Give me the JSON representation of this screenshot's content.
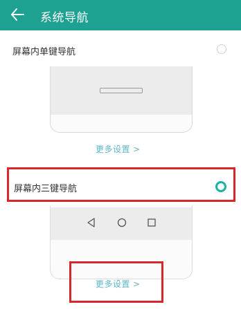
{
  "appbar": {
    "title": "系统导航",
    "back_icon": "back-arrow-icon"
  },
  "options": [
    {
      "label": "屏幕内单键导航",
      "selected": false,
      "more_label": "更多设置"
    },
    {
      "label": "屏幕内三键导航",
      "selected": true,
      "more_label": "更多设置"
    }
  ],
  "chevron": ">",
  "colors": {
    "accent": "#1da291",
    "radio_on": "#17b3a3",
    "highlight": "#d8262b",
    "link": "#5bb8c9"
  }
}
